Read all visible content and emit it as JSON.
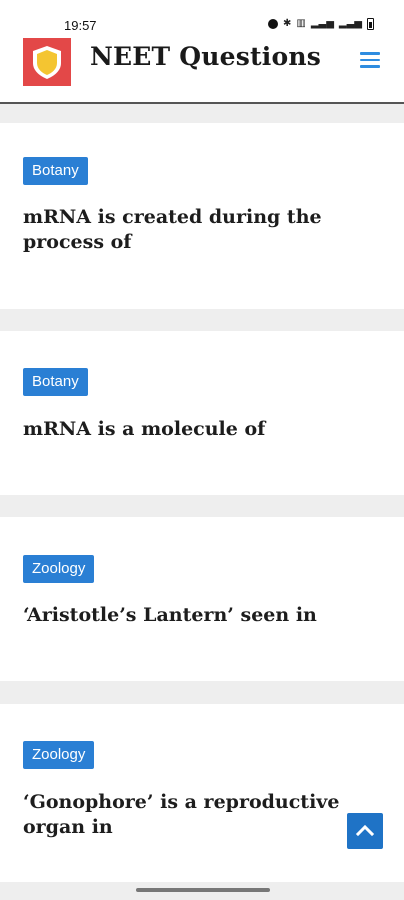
{
  "status_bar": {
    "time": "19:57",
    "icons": [
      "alarm-icon",
      "bluetooth-icon",
      "volte-icon",
      "signal-icon",
      "wifi-signal-icon",
      "battery-icon"
    ]
  },
  "header": {
    "site_title": "NEET Questions",
    "logo_icon": "shield-logo-icon",
    "menu_icon": "hamburger-menu-icon",
    "accent_color": "#2e8ce0",
    "logo_color": "#e34848"
  },
  "posts": [
    {
      "category": "Botany",
      "title_line1": "mRNA is created during the",
      "title_line2": "process of"
    },
    {
      "category": "Botany",
      "title_line1": "mRNA is a molecule of",
      "title_line2": ""
    },
    {
      "category": "Zoology",
      "title_line1": "‘Aristotle’s Lantern’ seen in",
      "title_line2": ""
    },
    {
      "category": "Zoology",
      "title_line1": "‘Gonophore’ is a reproductive",
      "title_line2": "organ in"
    }
  ],
  "badge_color": "#2a7fd4",
  "scroll_top_icon": "chevron-up-icon"
}
